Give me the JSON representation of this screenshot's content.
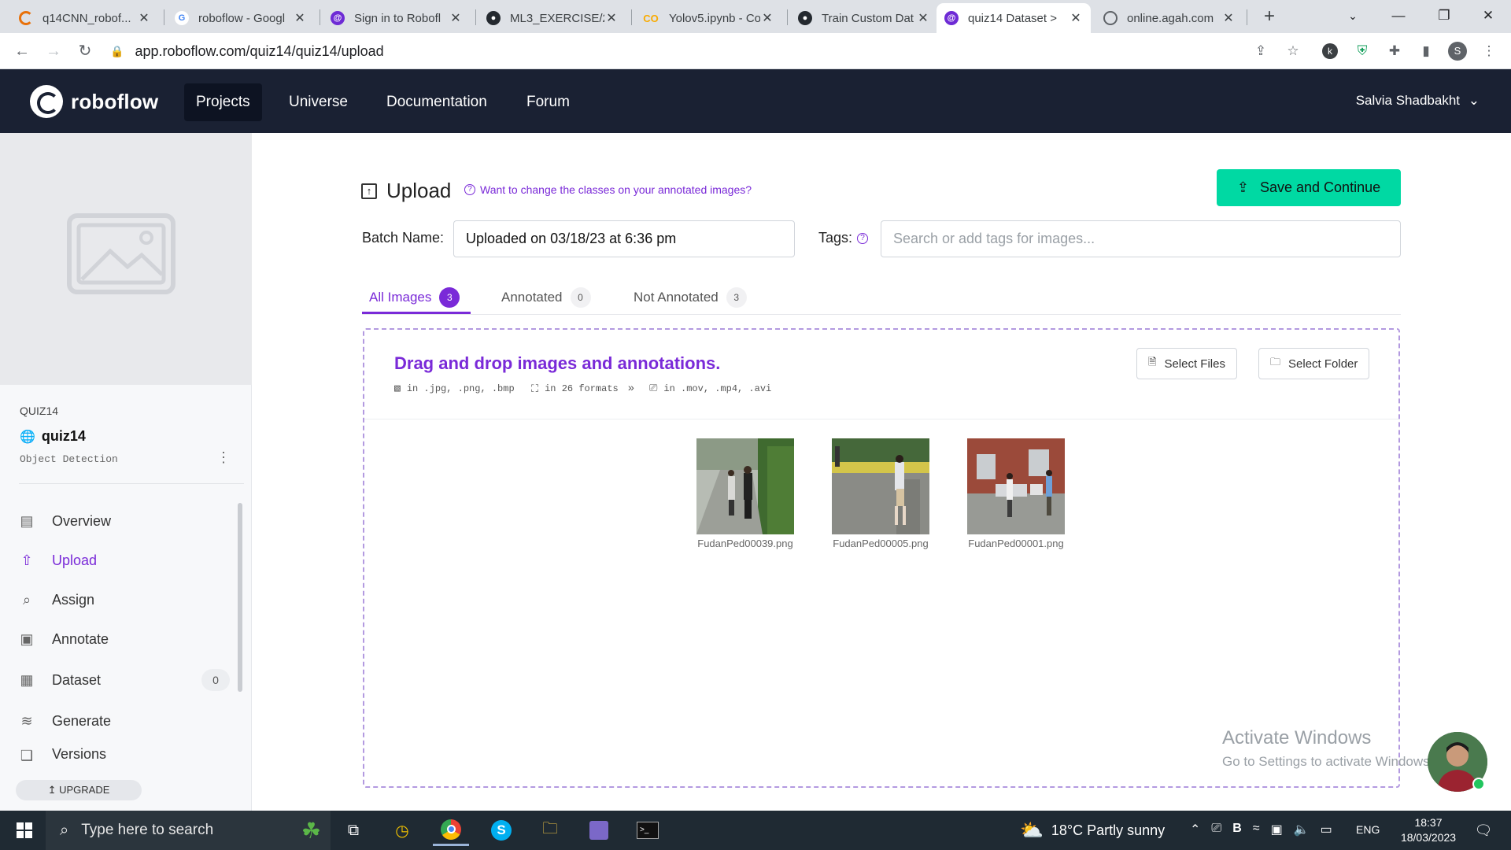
{
  "browser": {
    "tabs": [
      {
        "label": "q14CNN_robof...",
        "icon": "loader-icon",
        "color": "#e8710a"
      },
      {
        "label": "roboflow - Googl",
        "icon": "google-icon",
        "color": "#4285f4"
      },
      {
        "label": "Sign in to Robofl",
        "icon": "roboflow-icon",
        "color": "#6e2bd5"
      },
      {
        "label": "ML3_EXERCISE/2.",
        "icon": "github-icon",
        "color": "#24292f"
      },
      {
        "label": "Yolov5.ipynb - Co",
        "icon": "colab-icon",
        "color": "#f9ab00"
      },
      {
        "label": "Train Custom Dat",
        "icon": "github-icon",
        "color": "#24292f"
      },
      {
        "label": "quiz14 Dataset >",
        "icon": "roboflow-icon",
        "color": "#6e2bd5"
      },
      {
        "label": "online.agah.com",
        "icon": "globe-icon",
        "color": "#5f6368"
      }
    ],
    "url": "app.roboflow.com/quiz14/quiz14/upload",
    "profile_initial": "S"
  },
  "nav": {
    "brand": "roboflow",
    "links": [
      "Projects",
      "Universe",
      "Documentation",
      "Forum"
    ],
    "user": "Salvia Shadbakht"
  },
  "sidebar": {
    "workspace": "QUIZ14",
    "project": "quiz14",
    "project_type": "Object Detection",
    "items": [
      {
        "label": "Overview",
        "icon": "overview-icon"
      },
      {
        "label": "Upload",
        "icon": "upload-icon"
      },
      {
        "label": "Assign",
        "icon": "search-icon"
      },
      {
        "label": "Annotate",
        "icon": "annotate-icon"
      },
      {
        "label": "Dataset",
        "icon": "dataset-icon",
        "count": "0"
      },
      {
        "label": "Generate",
        "icon": "generate-icon"
      },
      {
        "label": "Versions",
        "icon": "versions-icon"
      }
    ],
    "upgrade": "UPGRADE"
  },
  "upload": {
    "title": "Upload",
    "help_link": "Want to change the classes on your annotated images?",
    "save_button": "Save and Continue",
    "batch_label": "Batch Name:",
    "batch_value": "Uploaded on 03/18/23 at 6:36 pm",
    "tags_label": "Tags:",
    "tags_placeholder": "Search or add tags for images...",
    "tabs": [
      {
        "label": "All Images",
        "count": "3"
      },
      {
        "label": "Annotated",
        "count": "0"
      },
      {
        "label": "Not Annotated",
        "count": "3"
      }
    ],
    "drop_title": "Drag and drop images and annotations.",
    "formats_images": "in .jpg, .png, .bmp",
    "formats_annotations": "in 26 formats",
    "formats_video": "in .mov, .mp4, .avi",
    "select_files": "Select Files",
    "select_folder": "Select Folder",
    "images": [
      "FudanPed00039.png",
      "FudanPed00005.png",
      "FudanPed00001.png"
    ]
  },
  "watermark": {
    "line1": "Activate Windows",
    "line2": "Go to Settings to activate Windows."
  },
  "taskbar": {
    "search_placeholder": "Type here to search",
    "weather": "18°C  Partly sunny",
    "language": "ENG",
    "time": "18:37",
    "date": "18/03/2023"
  },
  "colors": {
    "accent": "#7a2ad8",
    "save": "#00d9a3",
    "nav_bg": "#1a2133"
  }
}
